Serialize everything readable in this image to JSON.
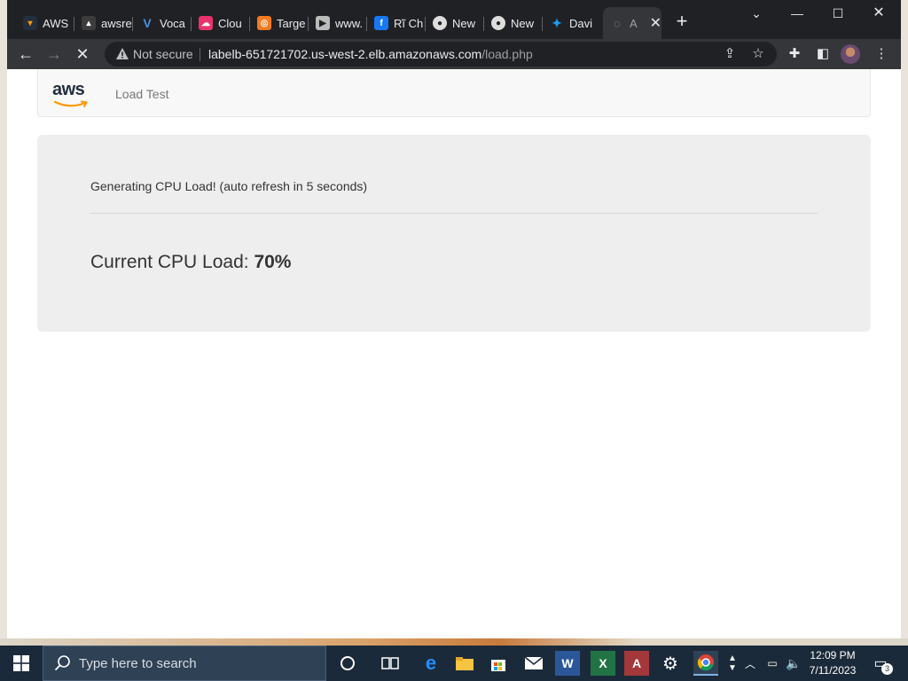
{
  "browser": {
    "tabs": [
      {
        "label": "AWS",
        "icon": "aws-tab-icon",
        "color": "#ff9900"
      },
      {
        "label": "awsre",
        "icon": "aws-re-tab-icon",
        "color": "#888888"
      },
      {
        "label": "Voca",
        "icon": "v-tab-icon",
        "color": "#4a90e2"
      },
      {
        "label": "Clou",
        "icon": "cloud-tab-icon",
        "color": "#e8336d"
      },
      {
        "label": "Targe",
        "icon": "target-tab-icon",
        "color": "#f47b20"
      },
      {
        "label": "www.",
        "icon": "youtube-tab-icon",
        "color": "#cccccc"
      },
      {
        "label": "Rĩ Ch",
        "icon": "facebook-tab-icon",
        "color": "#1877f2"
      },
      {
        "label": "New",
        "icon": "chrome-tab-icon",
        "color": "#dddddd"
      },
      {
        "label": "New",
        "icon": "chrome-tab-icon",
        "color": "#dddddd"
      },
      {
        "label": "Davi",
        "icon": "twitter-tab-icon",
        "color": "#1d9bf0"
      },
      {
        "label": "A",
        "icon": "loading-tab-icon",
        "color": "#9aa0a6"
      }
    ],
    "omnibox": {
      "security_label": "Not secure",
      "host": "labelb-651721702.us-west-2.elb.amazonaws.com",
      "path": "/load.php"
    }
  },
  "page": {
    "brand": "aws",
    "nav_title": "Load Test",
    "generating_text": "Generating CPU Load! (auto refresh in 5 seconds)",
    "cpu_label": "Current CPU Load:",
    "cpu_value": "70%"
  },
  "taskbar": {
    "search_placeholder": "Type here to search",
    "time": "12:09 PM",
    "date": "7/11/2023",
    "notification_count": "3"
  }
}
